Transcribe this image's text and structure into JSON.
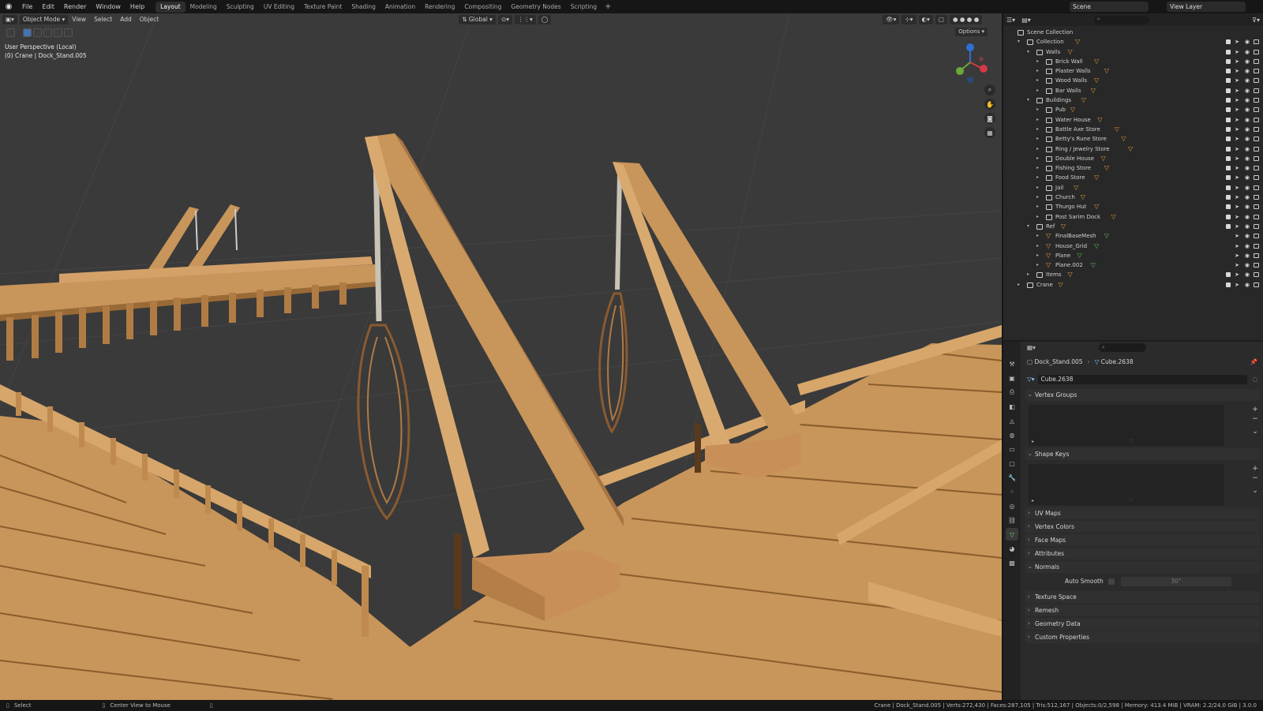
{
  "topbar": {
    "menus": [
      "File",
      "Edit",
      "Render",
      "Window",
      "Help"
    ],
    "workspaces": [
      "Layout",
      "Modeling",
      "Sculpting",
      "UV Editing",
      "Texture Paint",
      "Shading",
      "Animation",
      "Rendering",
      "Compositing",
      "Geometry Nodes",
      "Scripting"
    ],
    "active_workspace": "Layout",
    "scene": "Scene",
    "view_layer": "View Layer"
  },
  "viewport": {
    "mode": "Object Mode",
    "menus": [
      "View",
      "Select",
      "Add",
      "Object"
    ],
    "orientation": "Global",
    "options": "Options",
    "info_line1": "User Perspective (Local)",
    "info_line2": "(0) Crane | Dock_Stand.005",
    "colors": {
      "bg": "#3a3a3a",
      "wood": "#c8955a",
      "wood_dark": "#a0703a",
      "wood_light": "#dcae74",
      "grid": "#454545"
    }
  },
  "outliner": {
    "search_placeholder": "",
    "rows": [
      {
        "label": "Scene Collection",
        "depth": 0,
        "kind": "scene",
        "expanded": true
      },
      {
        "label": "Collection",
        "depth": 1,
        "kind": "coll",
        "expanded": true
      },
      {
        "label": "Walls",
        "depth": 2,
        "kind": "coll",
        "expanded": true
      },
      {
        "label": "Brick Wall",
        "depth": 3,
        "kind": "coll"
      },
      {
        "label": "Plaster Walls",
        "depth": 3,
        "kind": "coll"
      },
      {
        "label": "Wood Walls",
        "depth": 3,
        "kind": "coll"
      },
      {
        "label": "Bar Walls",
        "depth": 3,
        "kind": "coll"
      },
      {
        "label": "Buildings",
        "depth": 2,
        "kind": "coll",
        "expanded": true
      },
      {
        "label": "Pub",
        "depth": 3,
        "kind": "coll"
      },
      {
        "label": "Water House",
        "depth": 3,
        "kind": "coll"
      },
      {
        "label": "Battle Axe Store",
        "depth": 3,
        "kind": "coll"
      },
      {
        "label": "Betty's Rune Store",
        "depth": 3,
        "kind": "coll"
      },
      {
        "label": "Ring / Jewelry Store",
        "depth": 3,
        "kind": "coll"
      },
      {
        "label": "Double House",
        "depth": 3,
        "kind": "coll"
      },
      {
        "label": "Fishing Store",
        "depth": 3,
        "kind": "coll"
      },
      {
        "label": "Food Store",
        "depth": 3,
        "kind": "coll"
      },
      {
        "label": "Jail",
        "depth": 3,
        "kind": "coll"
      },
      {
        "label": "Church",
        "depth": 3,
        "kind": "coll"
      },
      {
        "label": "Thurgo Hut",
        "depth": 3,
        "kind": "coll"
      },
      {
        "label": "Post Sarim Dock",
        "depth": 3,
        "kind": "coll"
      },
      {
        "label": "Ref",
        "depth": 2,
        "kind": "coll",
        "expanded": true
      },
      {
        "label": "FinalBaseMesh",
        "depth": 3,
        "kind": "obj"
      },
      {
        "label": "House_Grid",
        "depth": 3,
        "kind": "obj"
      },
      {
        "label": "Plane",
        "depth": 3,
        "kind": "obj"
      },
      {
        "label": "Plane.002",
        "depth": 3,
        "kind": "obj"
      },
      {
        "label": "Items",
        "depth": 2,
        "kind": "coll"
      },
      {
        "label": "Crane",
        "depth": 1,
        "kind": "coll"
      }
    ]
  },
  "properties": {
    "breadcrumb_object": "Dock_Stand.005",
    "breadcrumb_mesh": "Cube.2638",
    "mesh_name": "Cube.2638",
    "panels": {
      "vertex_groups": "Vertex Groups",
      "shape_keys": "Shape Keys",
      "uv_maps": "UV Maps",
      "vertex_colors": "Vertex Colors",
      "face_maps": "Face Maps",
      "attributes": "Attributes",
      "normals": "Normals",
      "auto_smooth": "Auto Smooth",
      "auto_smooth_angle": "30°",
      "texture_space": "Texture Space",
      "remesh": "Remesh",
      "geometry_data": "Geometry Data",
      "custom_properties": "Custom Properties"
    }
  },
  "statusbar": {
    "select": "Select",
    "center_view": "Center View to Mouse",
    "stats": "Crane | Dock_Stand.005 | Verts:272,430 | Faces:287,105 | Tris:512,167 | Objects:0/2,598 | Memory: 413.4 MiB | VRAM: 2.2/24.0 GiB | 3.0.0"
  }
}
